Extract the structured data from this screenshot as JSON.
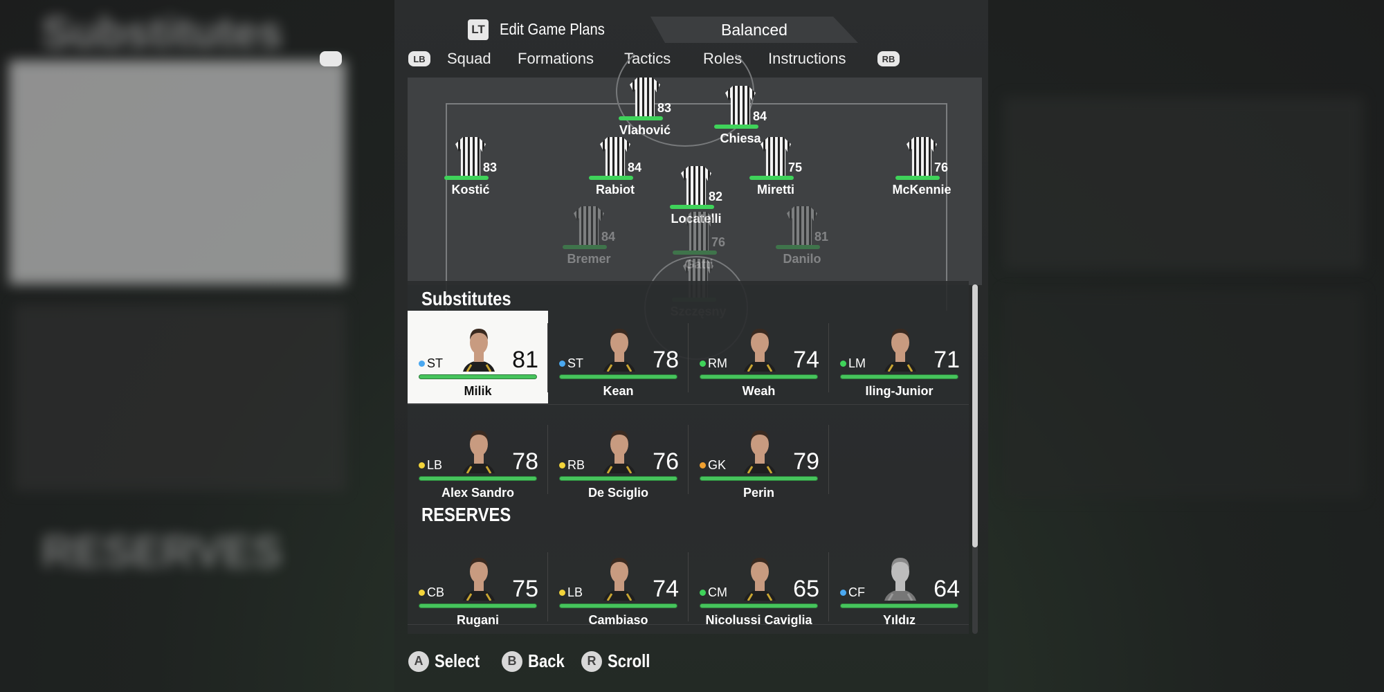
{
  "header": {
    "lt_button": "LT",
    "title": "Edit Game Plans",
    "game_plan": "Balanced"
  },
  "tabs": {
    "left_bumper": "LB",
    "right_bumper": "RB",
    "items": [
      {
        "label": "Squad"
      },
      {
        "label": "Formations"
      },
      {
        "label": "Tactics"
      },
      {
        "label": "Roles"
      },
      {
        "label": "Instructions"
      }
    ]
  },
  "pitch": {
    "players": [
      {
        "name": "Vlahović",
        "rating": "83"
      },
      {
        "name": "Chiesa",
        "rating": "84"
      },
      {
        "name": "Kostić",
        "rating": "83"
      },
      {
        "name": "Rabiot",
        "rating": "84"
      },
      {
        "name": "Miretti",
        "rating": "75"
      },
      {
        "name": "McKennie",
        "rating": "76"
      },
      {
        "name": "Locatelli",
        "rating": "82"
      },
      {
        "name": "Bremer",
        "rating": "84"
      },
      {
        "name": "Gatti",
        "rating": "76"
      },
      {
        "name": "Danilo",
        "rating": "81"
      },
      {
        "name": "Szczęsny",
        "rating": ""
      }
    ]
  },
  "substitutes": {
    "title": "Substitutes",
    "players": [
      {
        "name": "Milik",
        "position": "ST",
        "rating": "81",
        "dot": "#4aa8f0",
        "selected": true
      },
      {
        "name": "Kean",
        "position": "ST",
        "rating": "78",
        "dot": "#4aa8f0"
      },
      {
        "name": "Weah",
        "position": "RM",
        "rating": "74",
        "dot": "#3fd35a"
      },
      {
        "name": "Iling-Junior",
        "position": "LM",
        "rating": "71",
        "dot": "#3fd35a"
      },
      {
        "name": "Alex Sandro",
        "position": "LB",
        "rating": "78",
        "dot": "#f3d43a"
      },
      {
        "name": "De Sciglio",
        "position": "RB",
        "rating": "76",
        "dot": "#f3d43a"
      },
      {
        "name": "Perin",
        "position": "GK",
        "rating": "79",
        "dot": "#f0a030"
      }
    ]
  },
  "reserves": {
    "title": "RESERVES",
    "players": [
      {
        "name": "Rugani",
        "position": "CB",
        "rating": "75",
        "dot": "#f3d43a"
      },
      {
        "name": "Cambiaso",
        "position": "LB",
        "rating": "74",
        "dot": "#f3d43a"
      },
      {
        "name": "Nicolussi Caviglia",
        "position": "CM",
        "rating": "65",
        "dot": "#3fd35a"
      },
      {
        "name": "Yıldız",
        "position": "CF",
        "rating": "64",
        "dot": "#4aa8f0",
        "placeholder_face": true
      }
    ]
  },
  "footer": {
    "hints": [
      {
        "button": "A",
        "label": "Select"
      },
      {
        "button": "B",
        "label": "Back"
      },
      {
        "button": "R",
        "label": "Scroll"
      }
    ]
  },
  "colors": {
    "rating_bar": "#3fd35a",
    "panel": "#2b2d2e"
  }
}
